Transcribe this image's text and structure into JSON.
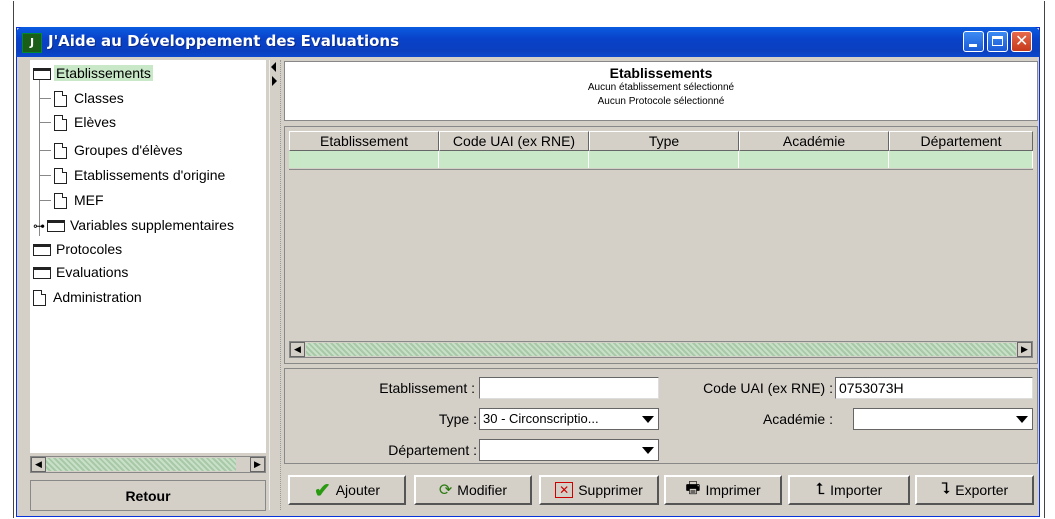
{
  "window": {
    "app_icon": "J",
    "title": "J'Aide au Développement des Evaluations",
    "controls": [
      "minimize-icon",
      "maximize-icon",
      "close-icon"
    ]
  },
  "tree": {
    "items": [
      {
        "label": "Etablissements",
        "type": "folder",
        "selected": true
      },
      {
        "label": "Classes",
        "type": "doc"
      },
      {
        "label": "Elèves",
        "type": "doc"
      },
      {
        "label": "Groupes d'élèves",
        "type": "doc"
      },
      {
        "label": "Etablissements d'origine",
        "type": "doc"
      },
      {
        "label": "MEF",
        "type": "doc"
      },
      {
        "label": "Variables supplementaires",
        "type": "folder"
      },
      {
        "label": "Protocoles",
        "type": "folder"
      },
      {
        "label": "Evaluations",
        "type": "folder"
      },
      {
        "label": "Administration",
        "type": "doc"
      }
    ]
  },
  "retour_label": "Retour",
  "header": {
    "title": "Etablissements",
    "line1": "Aucun établissement sélectionné",
    "line2": "Aucun Protocole sélectionné"
  },
  "table": {
    "columns": [
      "Etablissement",
      "Code UAI (ex RNE)",
      "Type",
      "Académie",
      "Département"
    ]
  },
  "form": {
    "etablissement_label": "Etablissement :",
    "etablissement_value": "",
    "code_label": "Code UAI (ex RNE) :",
    "code_value": "0753073H",
    "type_label": "Type :",
    "type_value": "30 - Circonscriptio...",
    "academie_label": "Académie :",
    "academie_value": "",
    "departement_label": "Département :",
    "departement_value": ""
  },
  "buttons": {
    "ajouter": "Ajouter",
    "modifier": "Modifier",
    "supprimer": "Supprimer",
    "imprimer": "Imprimer",
    "importer": "Importer",
    "exporter": "Exporter"
  },
  "colors": {
    "title_bar": "#0a3fbf",
    "selection": "#c8e8c8",
    "panel": "#d4d0c8"
  }
}
